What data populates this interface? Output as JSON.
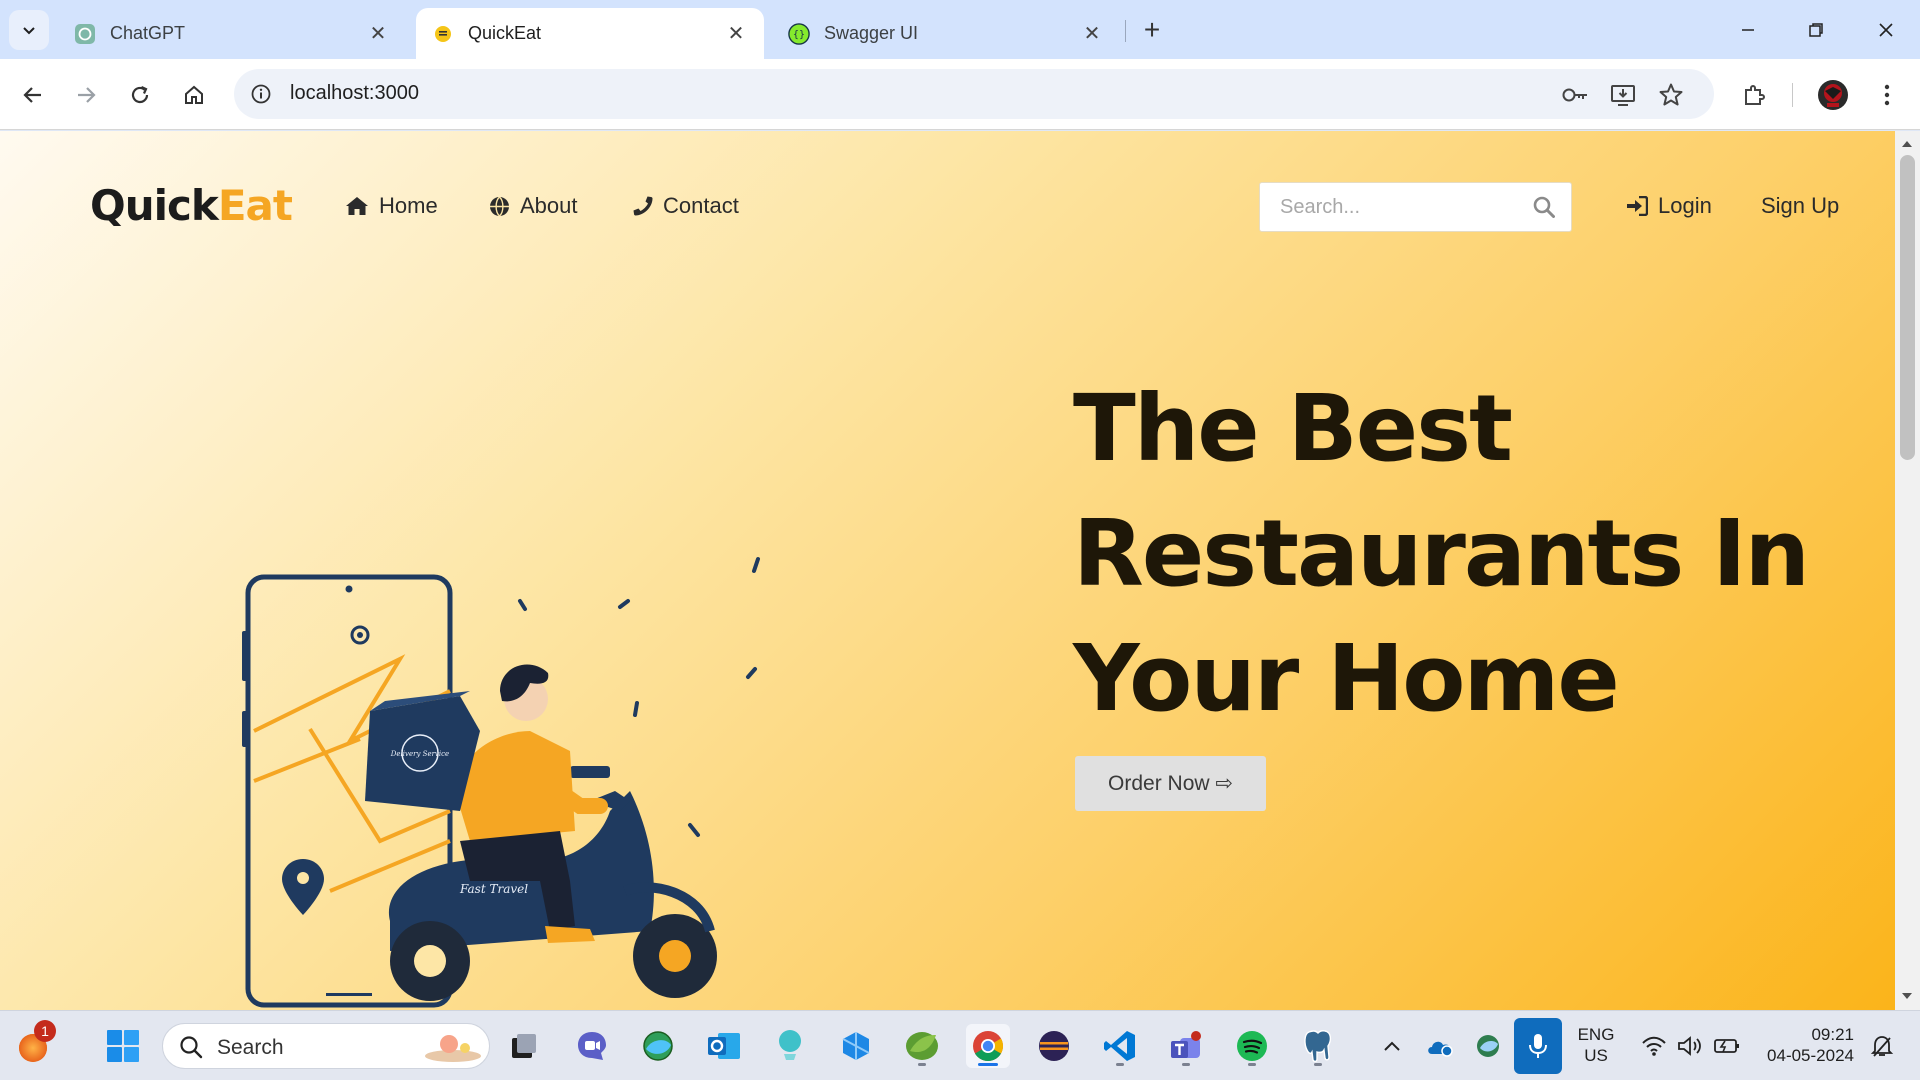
{
  "browser": {
    "tabs": [
      {
        "title": "ChatGPT",
        "icon": "chatgpt-icon",
        "active": false
      },
      {
        "title": "QuickEat",
        "icon": "quickeat-icon",
        "active": true
      },
      {
        "title": "Swagger UI",
        "icon": "swagger-icon",
        "active": false
      }
    ],
    "url": "localhost:3000"
  },
  "site": {
    "logo": {
      "part1": "Quick",
      "part2": "Eat"
    },
    "nav": [
      {
        "label": "Home",
        "icon": "home-icon"
      },
      {
        "label": "About",
        "icon": "globe-icon"
      },
      {
        "label": "Contact",
        "icon": "phone-icon"
      }
    ],
    "search_placeholder": "Search...",
    "login_label": "Login",
    "signup_label": "Sign Up",
    "hero": {
      "title_line1": "The Best",
      "title_line2": "Restaurants In",
      "title_line3": "Your Home",
      "cta_label": "Order Now ⇨"
    },
    "illustration": {
      "bag_text": "Delivery Service",
      "scooter_text": "Fast Travel"
    },
    "colors": {
      "accent": "#f5a623",
      "text": "#1e1708"
    }
  },
  "taskbar": {
    "search_label": "Search",
    "notification_count": "1",
    "language": "ENG",
    "region": "US",
    "time": "09:21",
    "date": "04-05-2024"
  }
}
